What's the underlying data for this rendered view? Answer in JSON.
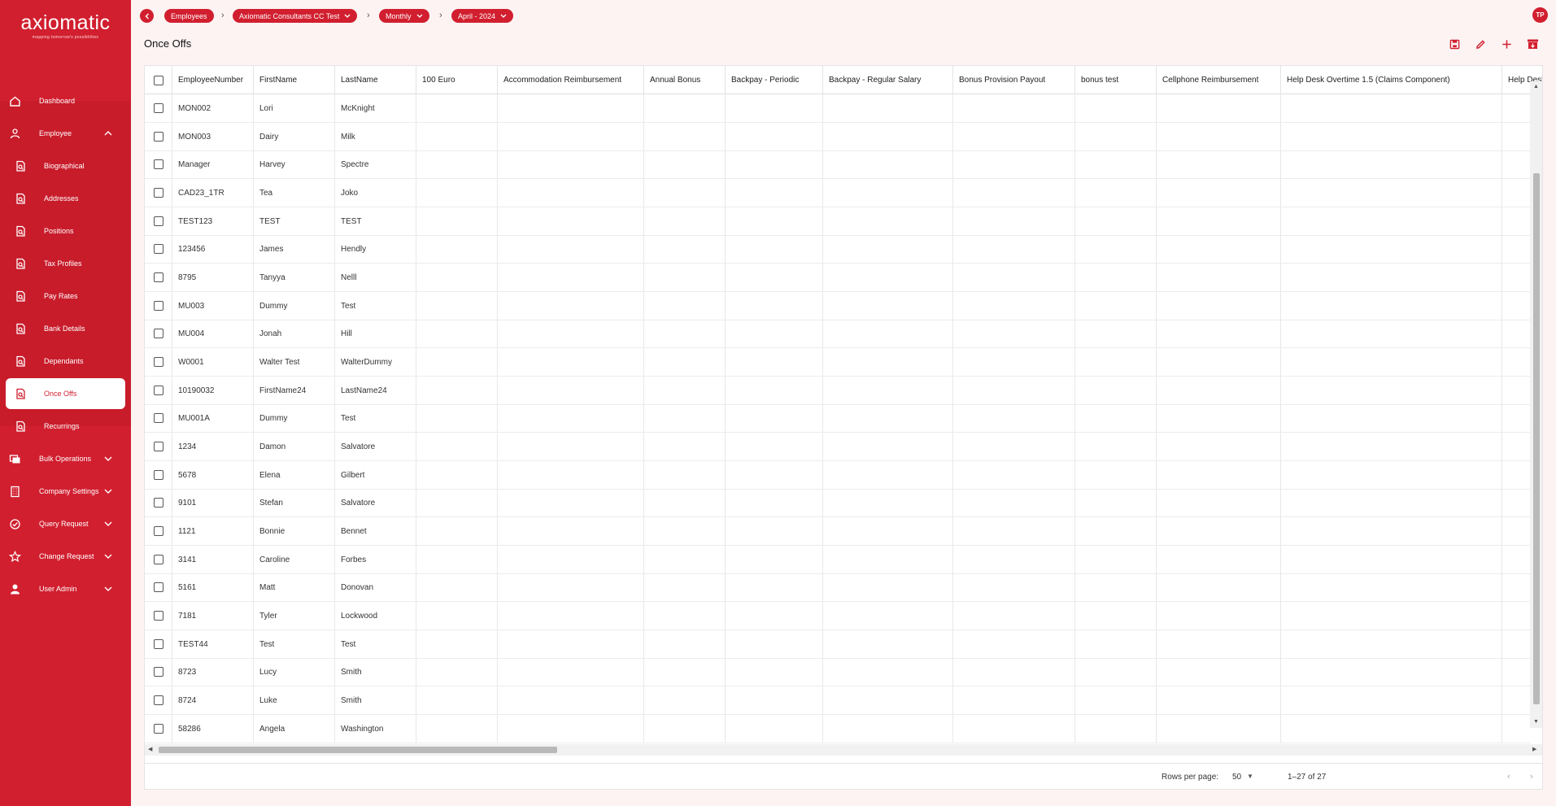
{
  "brand": {
    "name": "axiomatic",
    "tagline": "mapping tomorrow's possibilities"
  },
  "user": {
    "initials": "TP"
  },
  "sidebar": {
    "items": [
      {
        "label": "Dashboard",
        "icon": "home-icon"
      },
      {
        "label": "Employee",
        "icon": "person-icon"
      },
      {
        "label": "Biographical",
        "icon": "document-search-icon"
      },
      {
        "label": "Addresses",
        "icon": "document-search-icon"
      },
      {
        "label": "Positions",
        "icon": "document-search-icon"
      },
      {
        "label": "Tax Profiles",
        "icon": "document-search-icon"
      },
      {
        "label": "Pay Rates",
        "icon": "document-search-icon"
      },
      {
        "label": "Bank Details",
        "icon": "document-search-icon"
      },
      {
        "label": "Dependants",
        "icon": "document-search-icon"
      },
      {
        "label": "Once Offs",
        "icon": "document-search-icon"
      },
      {
        "label": "Recurrings",
        "icon": "document-search-icon"
      },
      {
        "label": "Bulk Operations",
        "icon": "cards-icon"
      },
      {
        "label": "Company Settings",
        "icon": "building-icon"
      },
      {
        "label": "Query Request",
        "icon": "check-circle-icon"
      },
      {
        "label": "Change Request",
        "icon": "star-icon"
      },
      {
        "label": "User Admin",
        "icon": "user-icon"
      }
    ]
  },
  "breadcrumb": {
    "items": [
      "Employees",
      "Axiomatic Consultants CC Test",
      "Monthly",
      "April - 2024"
    ]
  },
  "page": {
    "title": "Once Offs"
  },
  "toolbar": {
    "icons": [
      "save-icon",
      "edit-icon",
      "add-icon",
      "archive-icon"
    ]
  },
  "table": {
    "columns": [
      "EmployeeNumber",
      "FirstName",
      "LastName",
      "100 Euro",
      "Accommodation Reimbursement",
      "Annual Bonus",
      "Backpay - Periodic",
      "Backpay - Regular Salary",
      "Bonus Provision Payout",
      "bonus test",
      "Cellphone Reimbursement",
      "Help Desk Overtime 1.5 (Claims Component)",
      "Help Desk"
    ],
    "rows": [
      [
        "MON002",
        "Lori",
        "McKnight"
      ],
      [
        "MON003",
        "Dairy",
        "Milk"
      ],
      [
        "Manager",
        "Harvey",
        "Spectre"
      ],
      [
        "CAD23_1TR",
        "Tea",
        "Joko"
      ],
      [
        "TEST123",
        "TEST",
        "TEST"
      ],
      [
        "123456",
        "James",
        "Hendly"
      ],
      [
        "8795",
        "Tanyya",
        "Nelll"
      ],
      [
        "MU003",
        "Dummy",
        "Test"
      ],
      [
        "MU004",
        "Jonah",
        "Hill"
      ],
      [
        "W0001",
        "Walter Test",
        "WalterDummy"
      ],
      [
        "10190032",
        "FirstName24",
        "LastName24"
      ],
      [
        "MU001A",
        "Dummy",
        "Test"
      ],
      [
        "1234",
        "Damon",
        "Salvatore"
      ],
      [
        "5678",
        "Elena",
        "Gilbert"
      ],
      [
        "9101",
        "Stefan",
        "Salvatore"
      ],
      [
        "1121",
        "Bonnie",
        "Bennet"
      ],
      [
        "3141",
        "Caroline",
        "Forbes"
      ],
      [
        "5161",
        "Matt",
        "Donovan"
      ],
      [
        "7181",
        "Tyler",
        "Lockwood"
      ],
      [
        "TEST44",
        "Test",
        "Test"
      ],
      [
        "8723",
        "Lucy",
        "Smith"
      ],
      [
        "8724",
        "Luke",
        "Smith"
      ],
      [
        "58286",
        "Angela",
        "Washington"
      ]
    ]
  },
  "pagination": {
    "rows_per_page_label": "Rows per page:",
    "rows_per_page": "50",
    "range": "1–27 of 27"
  }
}
